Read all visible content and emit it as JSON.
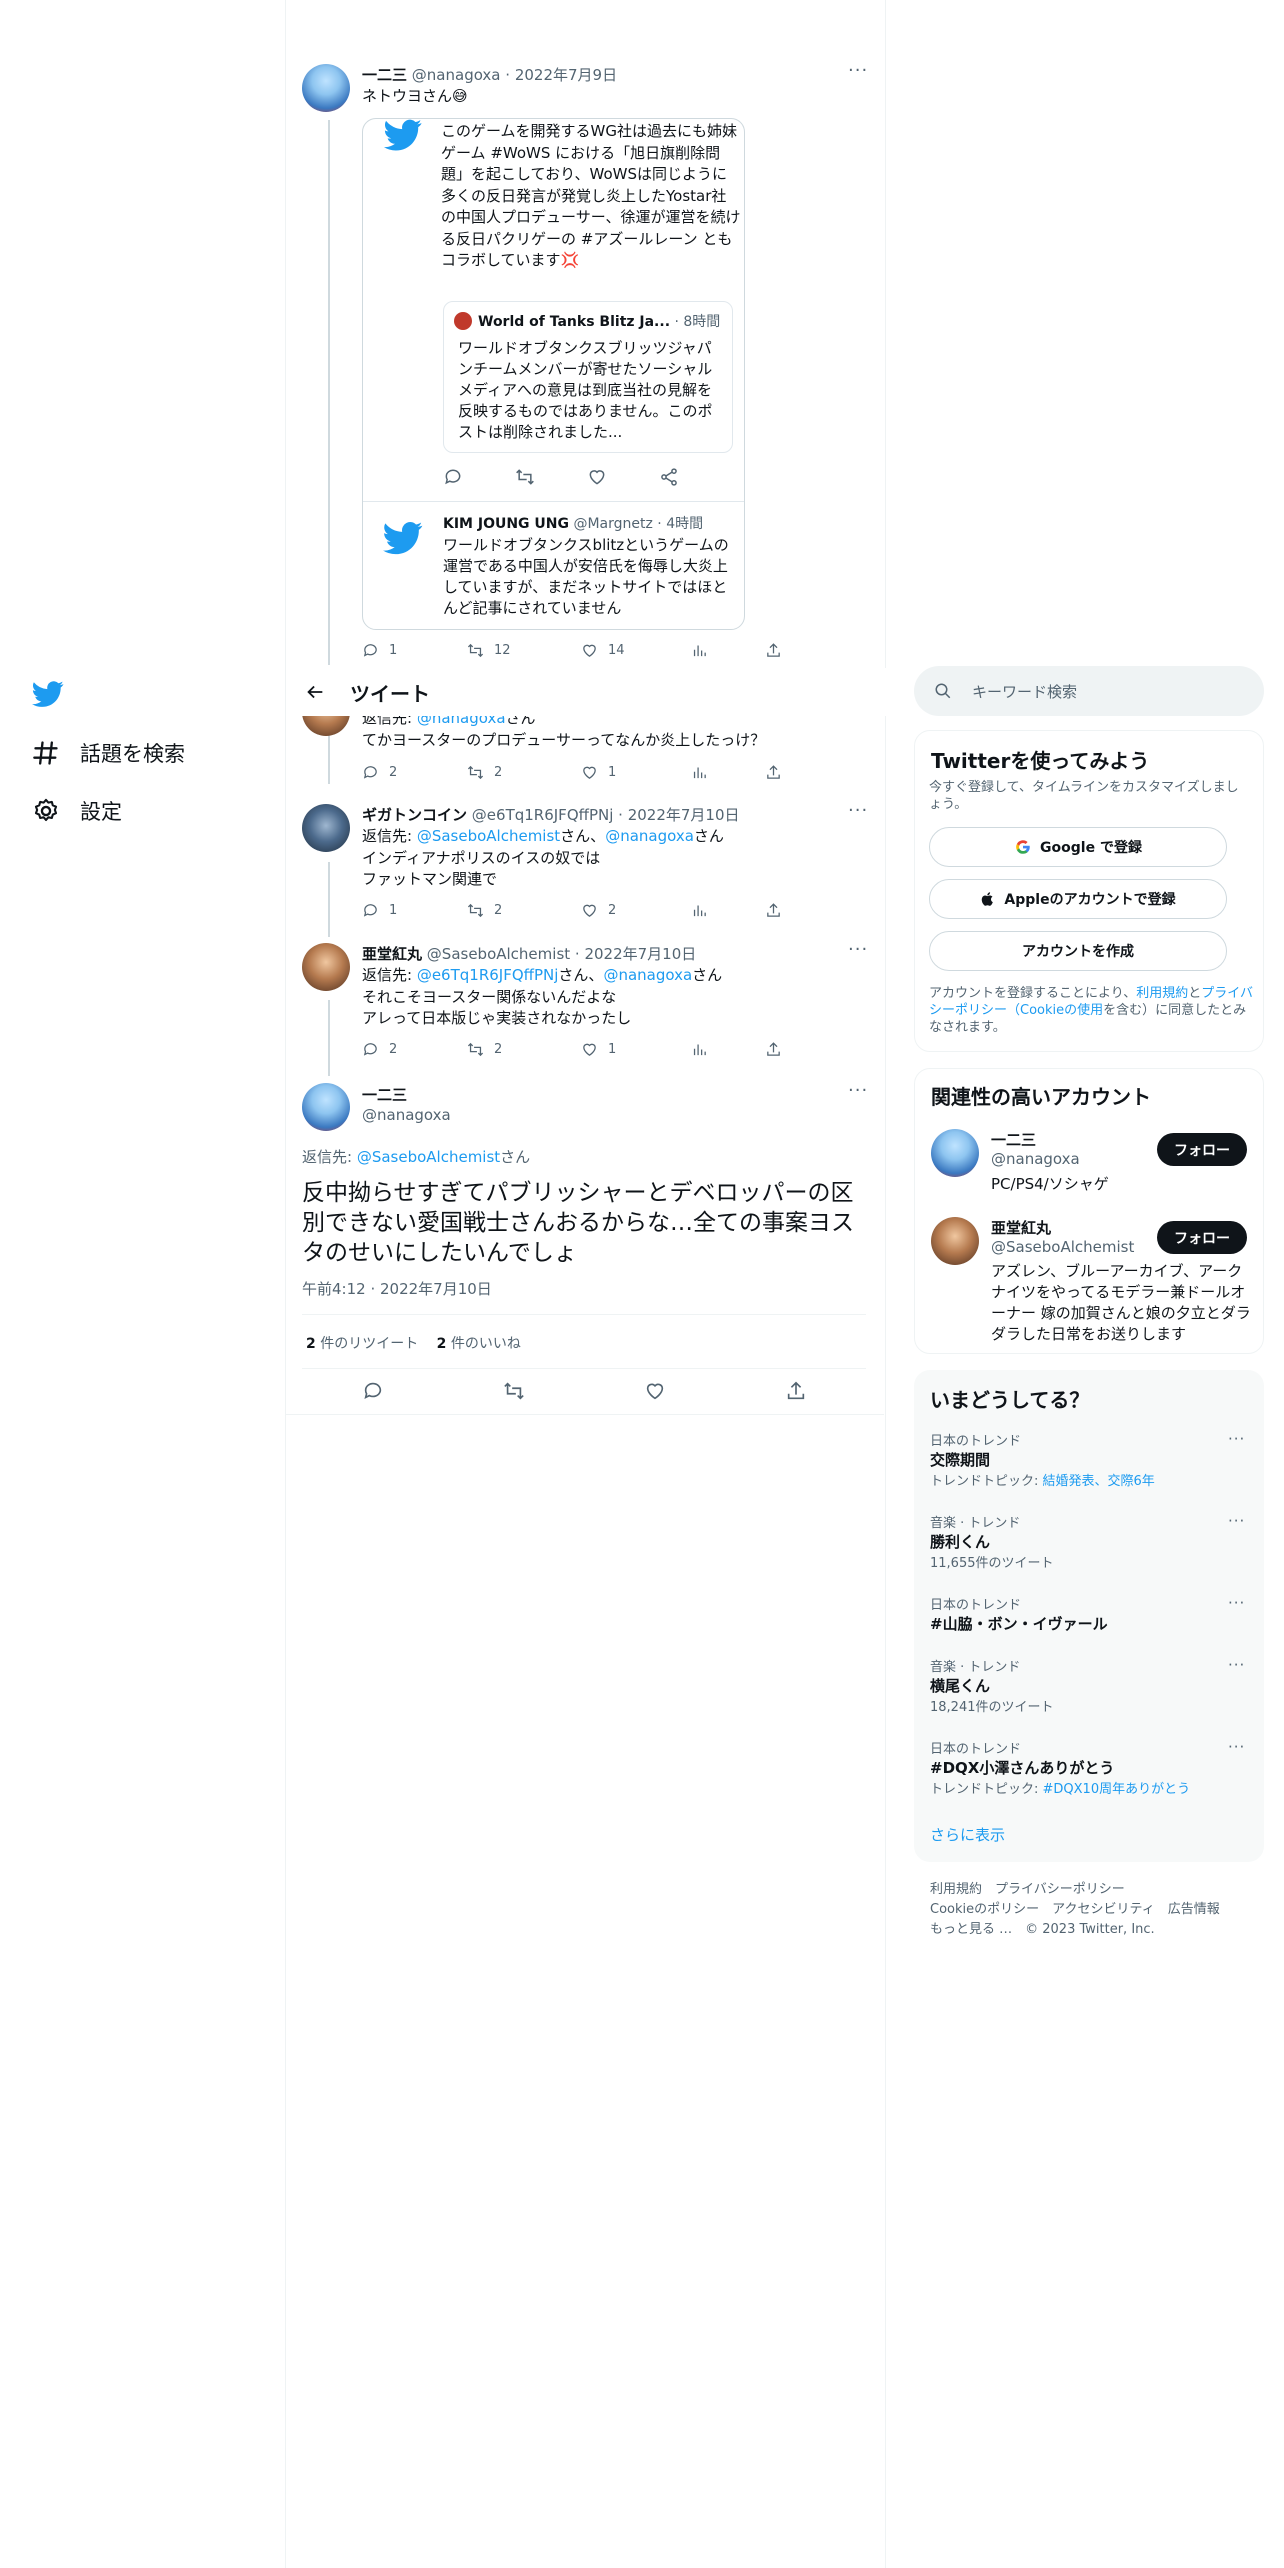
{
  "nav": {
    "items": [
      {
        "label": "話題を検索",
        "icon": "hash-icon"
      },
      {
        "label": "設定",
        "icon": "gear-icon"
      }
    ]
  },
  "header": {
    "title": "ツイート"
  },
  "tweets": [
    {
      "name": "一二三",
      "handle": "@nanagoxa",
      "date": "· 2022年7月9日",
      "text": "ネトウヨさん😅",
      "embed": {
        "text": "このゲームを開発するWG社は過去にも姉妹ゲーム #WoWS における「旭日旗削除問題」を起こしており、WoWSは同じように多くの反日発言が発覚し炎上したYostar社の中国人プロデューサー、徐運が運営を続ける反日パクリゲーの #アズールレーン ともコラボしています💢",
        "quote_name": "World of Tanks Blitz Ja...",
        "quote_time": "· 8時間",
        "quote_text": "ワールドオブタンクスブリッツジャパンチームメンバーが寄せたソーシャルメディアへの意見は到底当社の見解を反映するものではありません。このポストは削除されました...",
        "second_name": "KIM JOUNG UNG",
        "second_handle": "@Margnetz",
        "second_time": "· 4時間",
        "second_text": "ワールドオブタンクスblitzというゲームの運営である中国人が安倍氏を侮辱し大炎上していますが、まだネットサイトではほとんど記事にされていません"
      },
      "replies": "1",
      "retweets": "12",
      "likes": "14"
    },
    {
      "reply_to_label": "返信先: ",
      "reply_to": "@nanagoxa",
      "reply_suffix": "さん",
      "text": "てかヨースターのプロデューサーってなんか炎上したっけ？",
      "replies": "2",
      "retweets": "2",
      "likes": "1"
    },
    {
      "name": "ギガトンコイン",
      "handle": "@e6Tq1R6JFQffPNj",
      "date": "· 2022年7月10日",
      "reply_to_label": "返信先: ",
      "reply_to_1": "@SaseboAlchemist",
      "reply_mid": "さん、",
      "reply_to_2": "@nanagoxa",
      "reply_suffix": "さん",
      "text_1": "インディアナポリスのイスの奴では",
      "text_2": "ファットマン関連で",
      "replies": "1",
      "retweets": "2",
      "likes": "2"
    },
    {
      "name": "亜堂紅丸",
      "handle": "@SaseboAlchemist",
      "date": "· 2022年7月10日",
      "reply_to_label": "返信先: ",
      "reply_to_1": "@e6Tq1R6JFQffPNj",
      "reply_mid": "さん、",
      "reply_to_2": "@nanagoxa",
      "reply_suffix": "さん",
      "text_1": "それこそヨースター関係ないんだよな",
      "text_2": "アレって日本版じゃ実装されなかったし",
      "replies": "2",
      "retweets": "2",
      "likes": "1"
    }
  ],
  "main_tweet": {
    "name": "一二三",
    "handle": "@nanagoxa",
    "reply_to_label": "返信先: ",
    "reply_to": "@SaseboAlchemist",
    "reply_suffix": "さん",
    "text": "反中拗らせすぎてパブリッシャーとデベロッパーの区別できない愛国戦士さんおるからな…全ての事案ヨスタのせいにしたいんでしょ",
    "timestamp": "午前4:12 · 2022年7月10日",
    "retweet_count": "2",
    "retweet_label": " 件のリツイート",
    "like_count": "2",
    "like_label": " 件のいいね"
  },
  "sidebar": {
    "search_placeholder": "キーワード検索",
    "signup": {
      "title": "Twitterを使ってみよう",
      "subtitle": "今すぐ登録して、タイムラインをカスタマイズしましょう。",
      "google": "Google で登録",
      "apple": "Appleのアカウントで登録",
      "create": "アカウントを作成",
      "terms_1": "アカウントを登録することにより、",
      "terms_link_1": "利用規約",
      "terms_2": "と",
      "terms_link_2": "プライバシーポリシー（Cookieの使用",
      "terms_3": "を含む）に同意したとみなされます。"
    },
    "related": {
      "title": "関連性の高いアカウント",
      "accounts": [
        {
          "name": "一二三",
          "handle": "@nanagoxa",
          "bio": "PC/PS4/ソシャゲ",
          "follow": "フォロー"
        },
        {
          "name": "亜堂紅丸",
          "handle": "@SaseboAlchemist",
          "bio": "アズレン、ブルーアーカイブ、アークナイツをやってるモデラー兼ドールオーナー 嫁の加賀さんと娘の夕立とダラダラした日常をお送りします",
          "follow": "フォロー"
        }
      ]
    },
    "trends": {
      "title": "いまどうしてる？",
      "items": [
        {
          "meta": "日本のトレンド",
          "name": "交際期間",
          "sub_label": "トレンドトピック: ",
          "sub_link": "結婚発表、交際6年"
        },
        {
          "meta": "音楽 · トレンド",
          "name": "勝利くん",
          "sub_label": "11,655件のツイート",
          "sub_link": ""
        },
        {
          "meta": "日本のトレンド",
          "name": "#山脇・ボン・イヴァール",
          "sub_label": "",
          "sub_link": ""
        },
        {
          "meta": "音楽 · トレンド",
          "name": "横尾くん",
          "sub_label": "18,241件のツイート",
          "sub_link": ""
        },
        {
          "meta": "日本のトレンド",
          "name": "#DQX小澤さんありがとう",
          "sub_label": "トレンドトピック: ",
          "sub_link": "#DQX10周年ありがとう"
        }
      ],
      "show_more": "さらに表示"
    },
    "footer": {
      "line1": "利用規約　プライバシーポリシー",
      "line2": "Cookieのポリシー　アクセシビリティ　広告情報",
      "line3": "もっと見る …　© 2023 Twitter, Inc."
    }
  },
  "colors": {
    "accent": "#1d9bf0",
    "text": "#0f1419",
    "muted": "#536471",
    "border": "#eff3f4"
  }
}
